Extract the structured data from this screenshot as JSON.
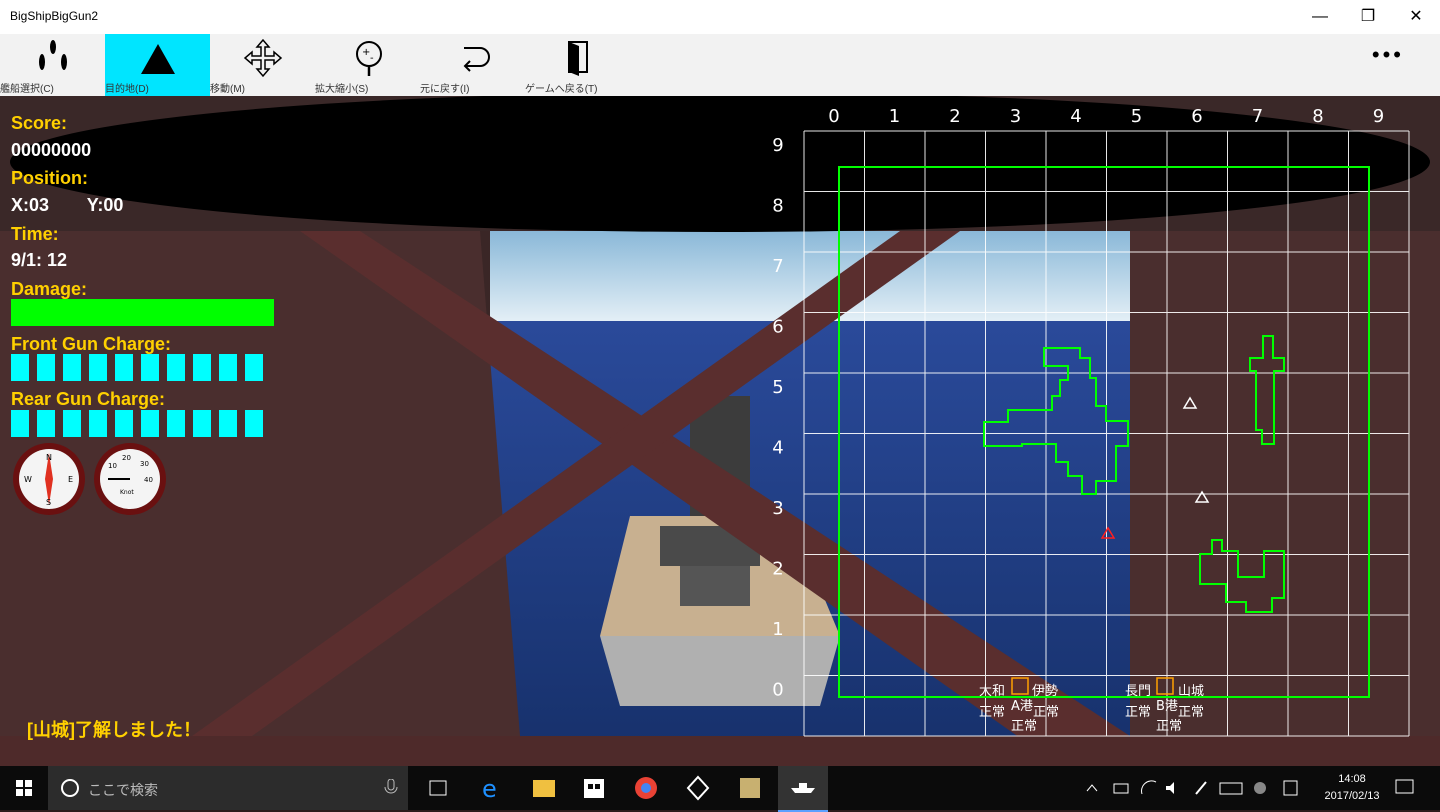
{
  "window": {
    "title": "BigShipBigGun2",
    "minimize": "—",
    "restore": "❐",
    "close": "✕"
  },
  "toolbar": {
    "items": [
      {
        "label": "艦船選択(C)",
        "icon": "ships-icon"
      },
      {
        "label": "目的地(D)",
        "icon": "triangle-icon",
        "active": true
      },
      {
        "label": "移動(M)",
        "icon": "move-arrows-icon"
      },
      {
        "label": "拡大縮小(S)",
        "icon": "zoom-icon"
      },
      {
        "label": "元に戻す(I)",
        "icon": "undo-icon"
      },
      {
        "label": "ゲームへ戻る(T)",
        "icon": "door-icon"
      }
    ],
    "more": "•••"
  },
  "hud": {
    "score_label": "Score:",
    "score": "00000000",
    "position_label": "Position:",
    "pos_x": "X:03",
    "pos_y": "Y:00",
    "time_label": "Time:",
    "time": "9/1: 12",
    "damage_label": "Damage:",
    "damage_level": 1.0,
    "front_label": "Front Gun Charge:",
    "front_charge": 10,
    "rear_label": "Rear Gun Charge:",
    "rear_charge": 10,
    "compass_labels": [
      "N",
      "W",
      "E",
      "S"
    ],
    "gauge_labels": [
      "20",
      "30",
      "40",
      "10",
      "Knot"
    ]
  },
  "map": {
    "col_labels": [
      "0",
      "1",
      "2",
      "3",
      "4",
      "5",
      "6",
      "7",
      "8",
      "9"
    ],
    "row_labels": [
      "9",
      "8",
      "7",
      "6",
      "5",
      "4",
      "3",
      "2",
      "1",
      "0"
    ],
    "port_a": {
      "left_ship": "大和",
      "right_ship": "伊勢",
      "status_left": "正常",
      "status_right": "正常",
      "name": "A港",
      "bottom": "正常"
    },
    "port_b": {
      "left_ship": "長門",
      "right_ship": "山城",
      "status_left": "正常",
      "status_right": "正常",
      "name": "B港",
      "bottom": "正常"
    },
    "colors": {
      "border": "#00ff00",
      "grid": "#ffffff",
      "marker": "#ff2020"
    }
  },
  "message": "[山城]了解しました！",
  "taskbar": {
    "search_placeholder": "ここで検索",
    "time": "14:08",
    "date": "2017/02/13"
  }
}
